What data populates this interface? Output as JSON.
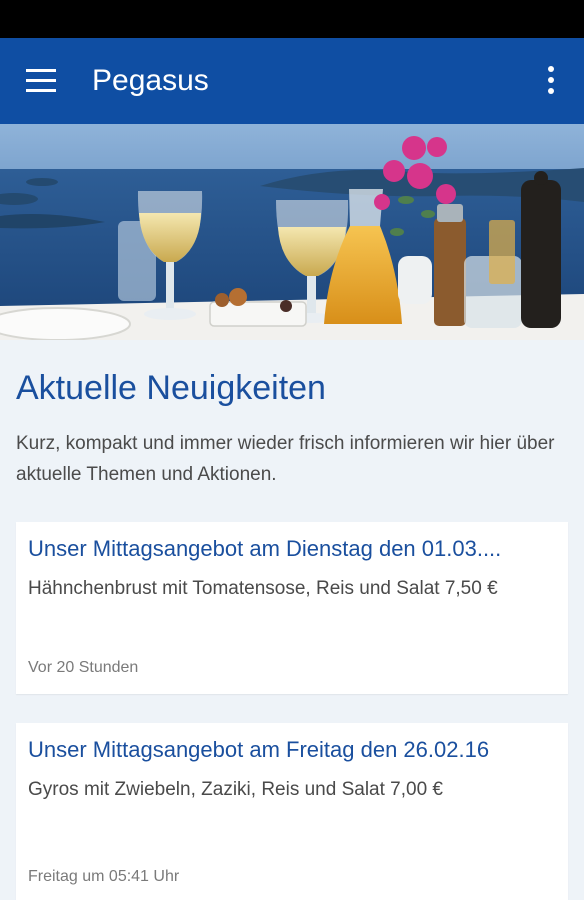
{
  "app": {
    "title": "Pegasus"
  },
  "icons": {
    "menu": "hamburger-menu-icon",
    "overflow": "more-vertical-icon"
  },
  "colors": {
    "app_bar": "#0f4ea3",
    "accent_text": "#1a4f9e",
    "background": "#eef3f8"
  },
  "main": {
    "title": "Aktuelle Neuigkeiten",
    "intro": "Kurz, kompakt und immer wieder frisch informieren wir hier über aktuelle Themen und Aktionen.",
    "posts": [
      {
        "title": "Unser Mittagsangebot am Dienstag den 01.03....",
        "text": "Hähnchenbrust mit Tomatensose, Reis und Salat 7,50 €",
        "time": "Vor 20 Stunden"
      },
      {
        "title": "Unser Mittagsangebot am Freitag den 26.02.16",
        "text": "Gyros mit Zwiebeln, Zaziki, Reis und Salat 7,00 €",
        "time": "Freitag um 05:41 Uhr"
      }
    ]
  }
}
